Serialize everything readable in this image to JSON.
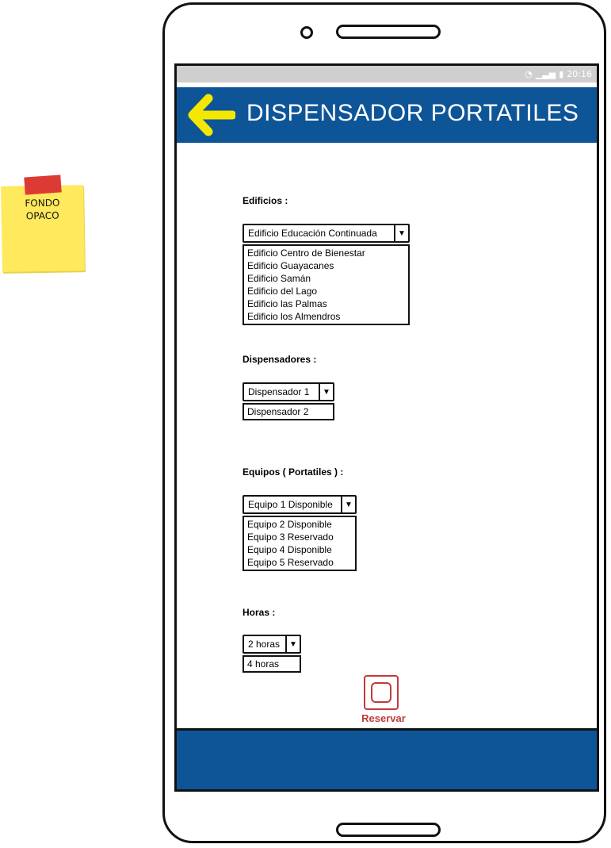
{
  "sticky_note": {
    "line1": "FONDO",
    "line2": "OPACO"
  },
  "status_bar": {
    "time": "20:16"
  },
  "app_bar": {
    "title": "DISPENSADOR PORTATILES"
  },
  "form": {
    "edificios": {
      "label": "Edificios :",
      "selected": "Edificio Educación Continuada",
      "options": [
        "Edificio Centro de Bienestar",
        "Edificio Guayacanes",
        "Edificio Samán",
        "Edificio del Lago",
        "Edificio las Palmas",
        "Edificio los Almendros"
      ]
    },
    "dispensadores": {
      "label": "Dispensadores :",
      "selected": "Dispensador 1",
      "options": [
        "Dispensador 2"
      ]
    },
    "equipos": {
      "label": "Equipos ( Portatiles ) :",
      "selected": "Equipo 1 Disponible",
      "options": [
        "Equipo 2 Disponible",
        "Equipo 3 Reservado",
        "Equipo 4 Disponible",
        "Equipo 5 Reservado"
      ]
    },
    "horas": {
      "label": "Horas :",
      "selected": "2 horas",
      "options": [
        "4 horas"
      ]
    },
    "reservar_label": "Reservar"
  },
  "colors": {
    "app_bar": "#0e5598",
    "back_arrow": "#f5e800",
    "reservar": "#c23a3a",
    "sticky_note": "#ffe95c"
  }
}
